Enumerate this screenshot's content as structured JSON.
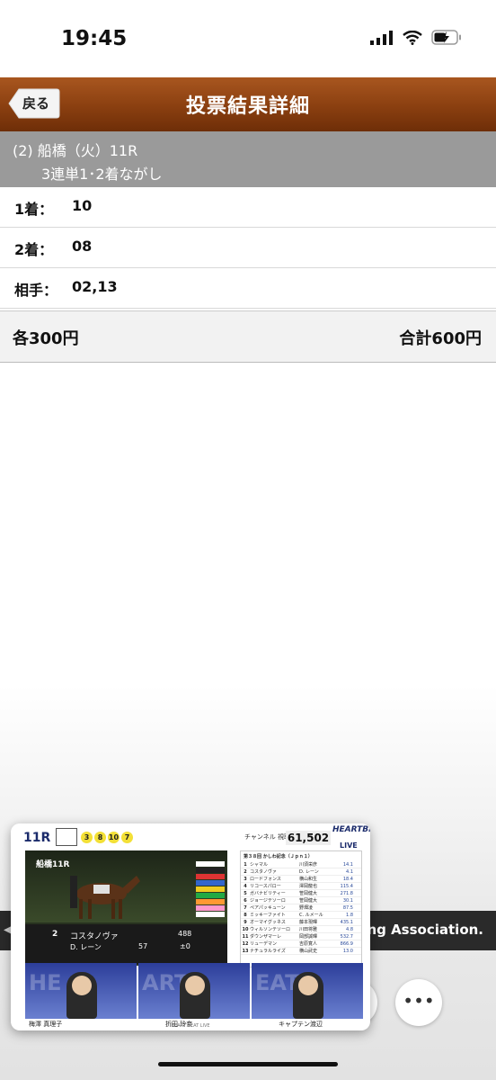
{
  "status_bar": {
    "time": "19:45"
  },
  "header": {
    "back_label": "戻る",
    "title": "投票結果詳細"
  },
  "race": {
    "line1": "(2) 船橋（火）11R",
    "line2": "3連単1･2着ながし"
  },
  "rows": [
    {
      "label": "1着：",
      "value": "10"
    },
    {
      "label": "2着：",
      "value": "08"
    },
    {
      "label": "相手：",
      "value": "02,13"
    }
  ],
  "total": {
    "each": "各300円",
    "sum": "合計600円"
  },
  "banner": {
    "text": "Racing Association."
  },
  "more_button": {
    "label": "•••"
  },
  "pip": {
    "race_no": "11R",
    "balls": [
      "3",
      "8",
      "10",
      "7"
    ],
    "channel_label": "チャンネル 視聴者数",
    "viewer_count": "61,502",
    "logo_line1": "HEARTBEAT",
    "logo_line2": "LIVE",
    "video_track": "船橋11R",
    "horse_number": "2",
    "horse_name": "コスタノヴァ",
    "jockey": "D. レーン",
    "weight": "57",
    "body_weight": "488",
    "diff": "±0",
    "table_title": "第３８回 かしわ記念（Ｊｐｎ１）",
    "table_rows": [
      {
        "n": "1",
        "h": "シャマル",
        "j": "川須栄彦",
        "o": "14.1"
      },
      {
        "n": "2",
        "h": "コスタノヴァ",
        "j": "D. レーン",
        "o": "4.1"
      },
      {
        "n": "3",
        "h": "ロードフォンス",
        "j": "横山和生",
        "o": "18.4"
      },
      {
        "n": "4",
        "h": "リコースパロー",
        "j": "澤岡龍也",
        "o": "115.4"
      },
      {
        "n": "5",
        "h": "ガバナビリティー",
        "j": "笹岡健大",
        "o": "271.8"
      },
      {
        "n": "6",
        "h": "ジョージテソーロ",
        "j": "笹岡健大",
        "o": "30.1"
      },
      {
        "n": "7",
        "h": "ペアパッキューン",
        "j": "野畑凌",
        "o": "87.5"
      },
      {
        "n": "8",
        "h": "ミッキーファイト",
        "j": "C. ルメール",
        "o": "1.8"
      },
      {
        "n": "9",
        "h": "オーマイグッネス",
        "j": "藤本現暉",
        "o": "435.1"
      },
      {
        "n": "10",
        "h": "ウィルソンテソーロ",
        "j": "川田将雅",
        "o": "4.8"
      },
      {
        "n": "11",
        "h": "ダウンザマーレ",
        "j": "岡部誠暉",
        "o": "532.7"
      },
      {
        "n": "12",
        "h": "リューデマン",
        "j": "吉原寛人",
        "o": "866.9"
      },
      {
        "n": "13",
        "h": "ナチュラルライズ",
        "j": "横山武史",
        "o": "13.0"
      }
    ],
    "casters": [
      "梅澤 真理子",
      "折田 玲奈",
      "キャプテン渡辺"
    ],
    "footer": "HEART BEAT LIVE"
  },
  "colors": {
    "header": "#8a3f10",
    "race_bar": "#9a9a9a",
    "accent_navy": "#1b2b6b"
  }
}
